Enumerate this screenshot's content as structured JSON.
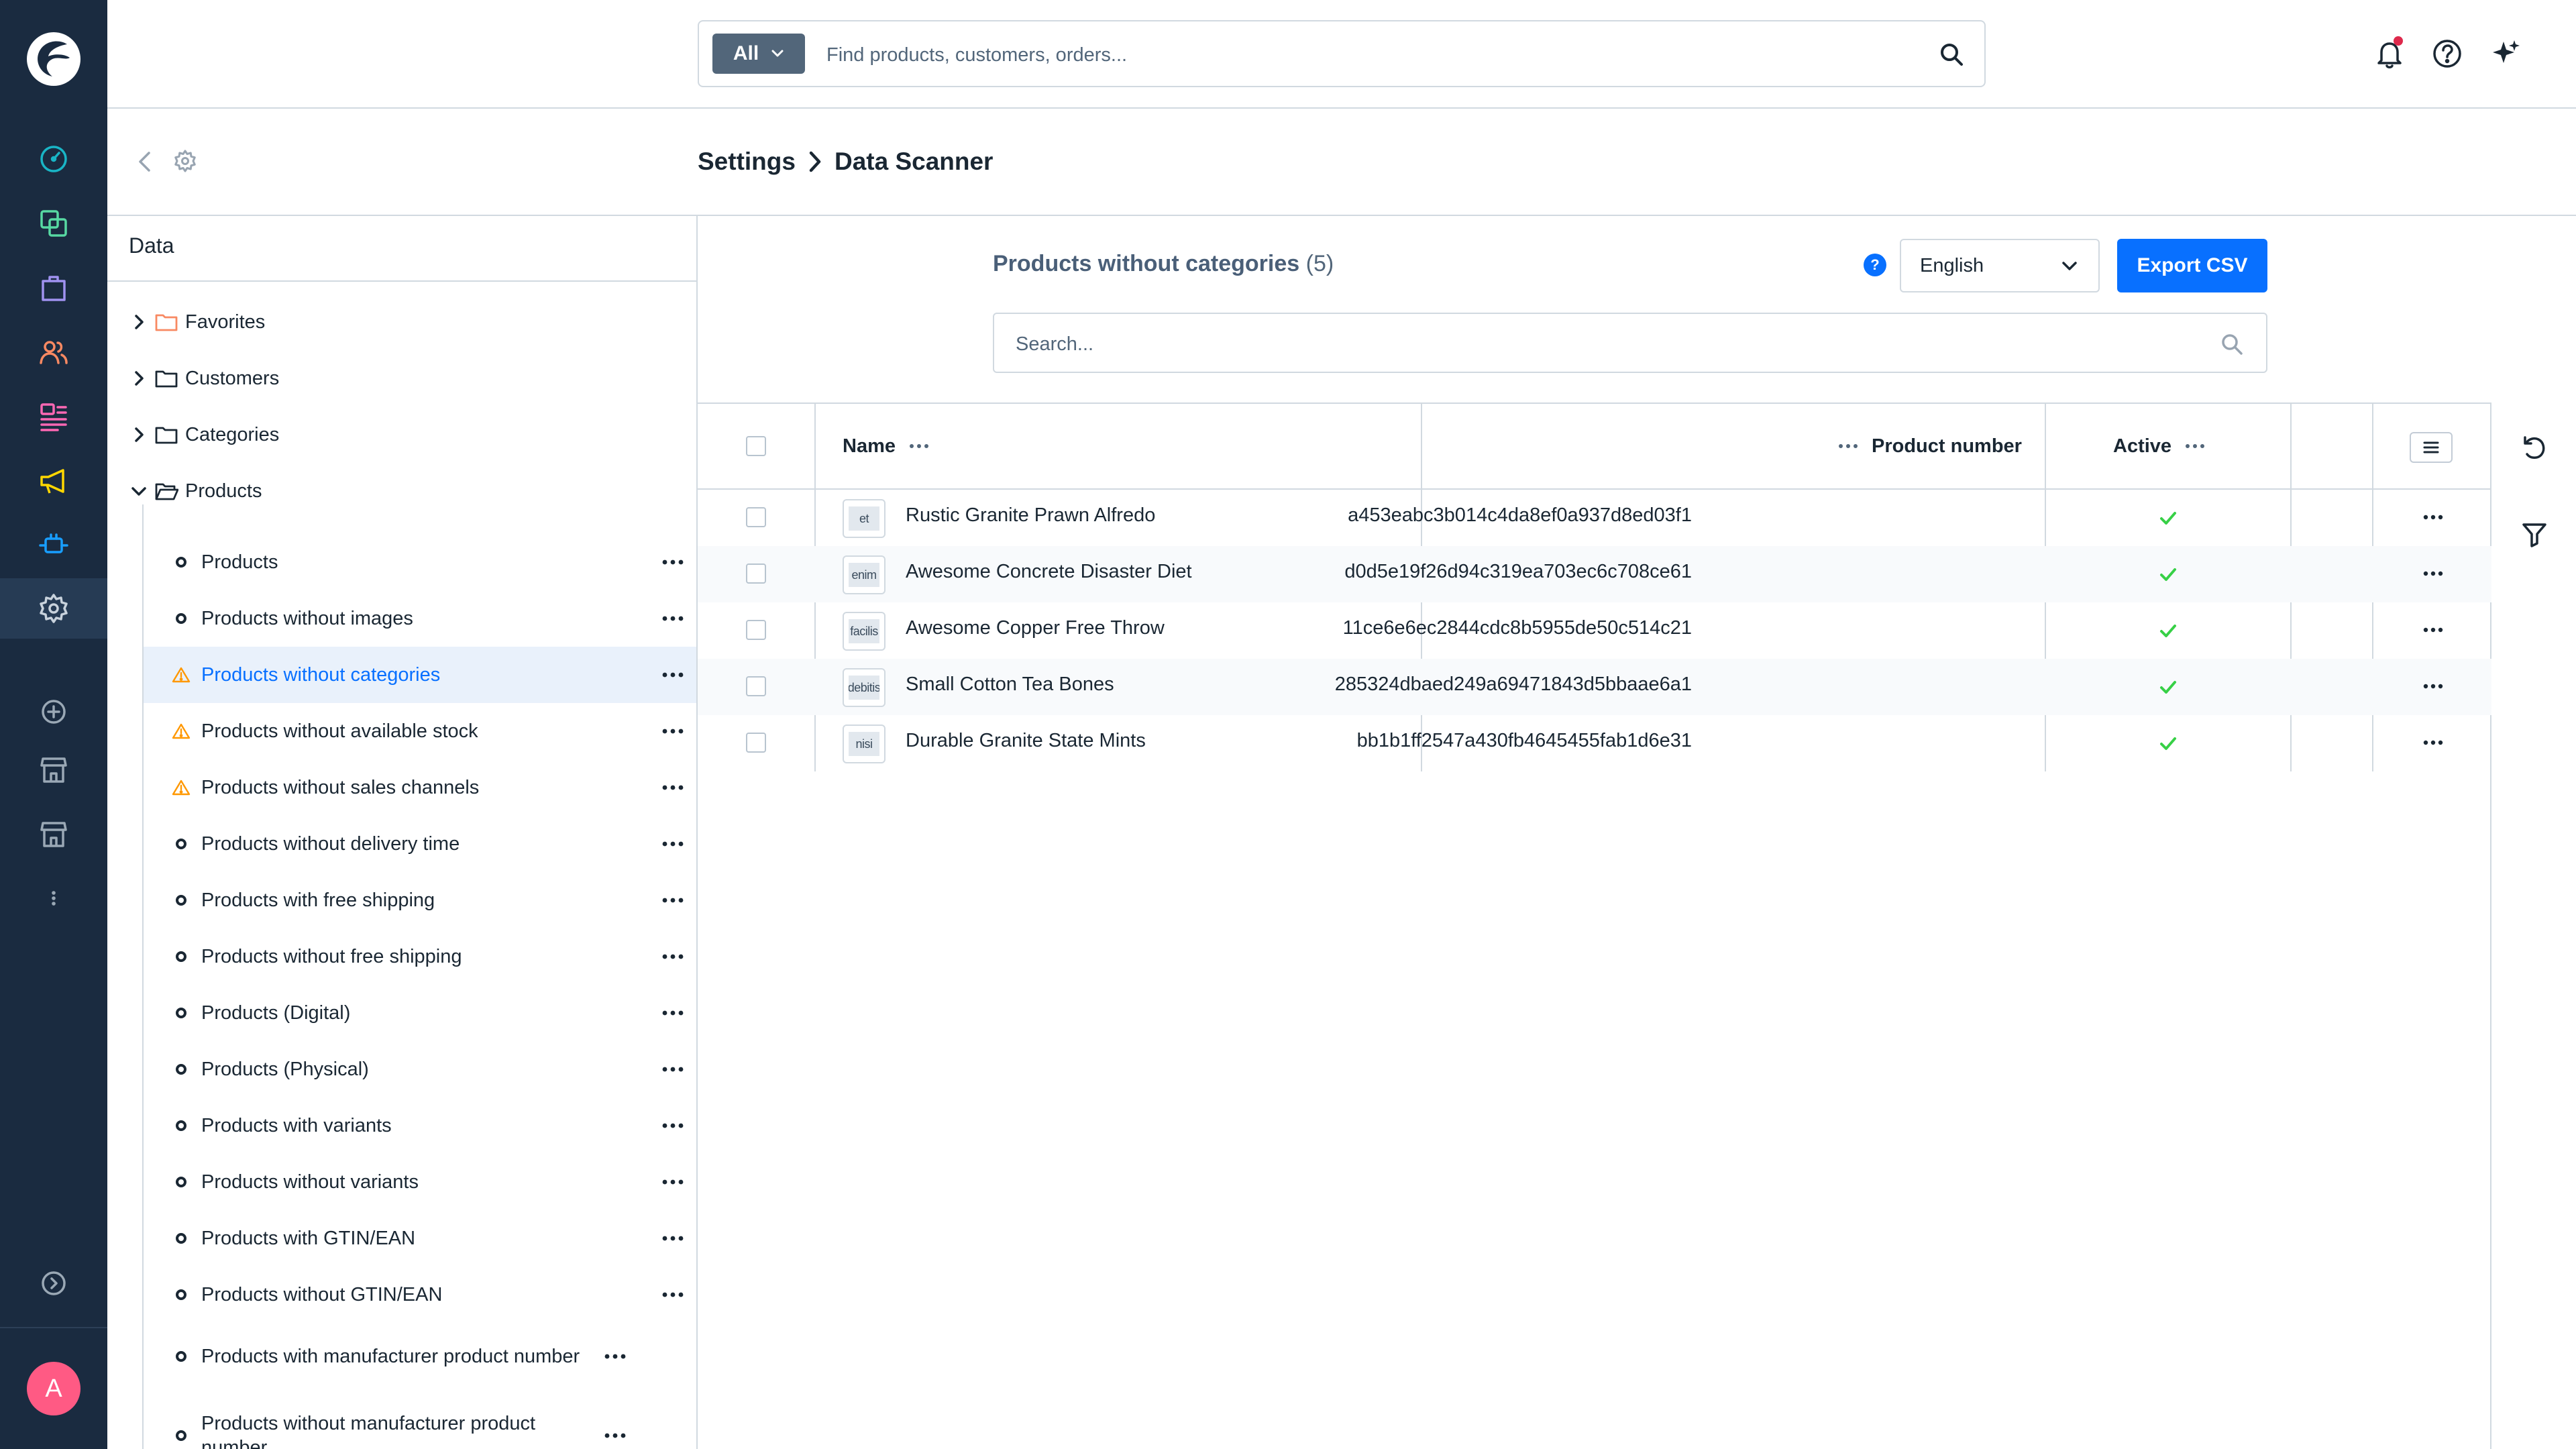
{
  "colors": {
    "accent": "#0870ff",
    "nav_bg": "#1a2b40",
    "warning": "#ff9800",
    "success": "#37d046",
    "avatar": "#ff5a84"
  },
  "sidenav": {
    "items": [
      {
        "name": "dashboard",
        "icon": "gauge-icon",
        "color": "#19b5c6"
      },
      {
        "name": "catalogues",
        "icon": "layers-icon",
        "color": "#57d9a3"
      },
      {
        "name": "orders",
        "icon": "shopping-bag-icon",
        "color": "#a092f0"
      },
      {
        "name": "customers",
        "icon": "users-icon",
        "color": "#f88962"
      },
      {
        "name": "content",
        "icon": "content-icon",
        "color": "#ff68b4"
      },
      {
        "name": "marketing",
        "icon": "megaphone-icon",
        "color": "#ffd700"
      },
      {
        "name": "extensions",
        "icon": "plug-icon",
        "color": "#189eff"
      },
      {
        "name": "settings",
        "icon": "gear-icon",
        "color": "#9aa8b5"
      },
      {
        "name": "add-sales-channel",
        "icon": "plus-circle-icon",
        "color": "#9aa8b5"
      },
      {
        "name": "storefront",
        "icon": "storefront-icon",
        "color": "#9aa8b5"
      },
      {
        "name": "headless",
        "icon": "storefront-icon",
        "color": "#9aa8b5"
      },
      {
        "name": "more",
        "icon": "more-vertical-icon",
        "color": "#9aa8b5"
      },
      {
        "name": "expand",
        "icon": "expand-circle-icon",
        "color": "#9aa8b5"
      }
    ],
    "avatar": "A"
  },
  "topbar": {
    "search_type": "All",
    "search_placeholder": "Find products, customers, orders..."
  },
  "breadcrumb": {
    "parent": "Settings",
    "current": "Data Scanner"
  },
  "tree": {
    "title": "Data",
    "roots": [
      {
        "label": "Favorites",
        "expanded": false
      },
      {
        "label": "Customers",
        "expanded": false
      },
      {
        "label": "Categories",
        "expanded": false
      },
      {
        "label": "Products",
        "expanded": true
      }
    ],
    "items": [
      {
        "label": "Products",
        "status": "ok"
      },
      {
        "label": "Products without images",
        "status": "ok"
      },
      {
        "label": "Products without categories",
        "status": "warning",
        "selected": true
      },
      {
        "label": "Products without available stock",
        "status": "warning"
      },
      {
        "label": "Products without sales channels",
        "status": "warning"
      },
      {
        "label": "Products without delivery time",
        "status": "ok"
      },
      {
        "label": "Products with free shipping",
        "status": "ok"
      },
      {
        "label": "Products without free shipping",
        "status": "ok"
      },
      {
        "label": "Products (Digital)",
        "status": "ok"
      },
      {
        "label": "Products (Physical)",
        "status": "ok"
      },
      {
        "label": "Products with variants",
        "status": "ok"
      },
      {
        "label": "Products without variants",
        "status": "ok"
      },
      {
        "label": "Products with GTIN/EAN",
        "status": "ok"
      },
      {
        "label": "Products without GTIN/EAN",
        "status": "ok"
      },
      {
        "label": "Products with manufacturer product number",
        "status": "ok"
      },
      {
        "label": "Products without manufacturer product number",
        "status": "ok"
      }
    ]
  },
  "list": {
    "title": "Products without categories",
    "count": "(5)",
    "language": "English",
    "export_label": "Export CSV",
    "search_placeholder": "Search...",
    "columns": {
      "name": "Name",
      "number": "Product number",
      "active": "Active"
    },
    "rows": [
      {
        "thumb": "et",
        "name": "Rustic Granite Prawn Alfredo",
        "number": "a453eabc3b014c4da8ef0a937d8ed03f1",
        "active": true
      },
      {
        "thumb": "enim",
        "name": "Awesome Concrete Disaster Diet",
        "number": "d0d5e19f26d94c319ea703ec6c708ce61",
        "active": true
      },
      {
        "thumb": "facilis",
        "name": "Awesome Copper Free Throw",
        "number": "11ce6e6ec2844cdc8b5955de50c514c21",
        "active": true
      },
      {
        "thumb": "debitis",
        "name": "Small Cotton Tea Bones",
        "number": "285324dbaed249a69471843d5bbaae6a1",
        "active": true
      },
      {
        "thumb": "nisi",
        "name": "Durable Granite State Mints",
        "number": "bb1b1ff2547a430fb4645455fab1d6e31",
        "active": true
      }
    ]
  },
  "right_rail": [
    {
      "icon": "refresh-icon"
    },
    {
      "icon": "filter-icon"
    }
  ]
}
